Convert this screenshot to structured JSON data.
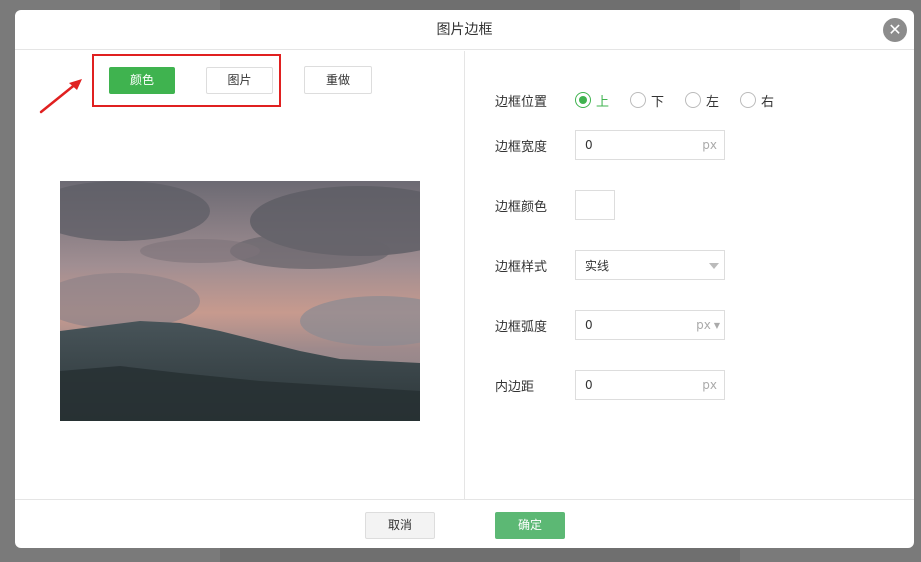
{
  "dialog": {
    "title": "图片边框",
    "close_glyph": "✕"
  },
  "tabs": {
    "color": "颜色",
    "image": "图片",
    "redo": "重做"
  },
  "settings": {
    "position": {
      "label": "边框位置",
      "options": [
        "上",
        "下",
        "左",
        "右"
      ],
      "selected": "上"
    },
    "width": {
      "label": "边框宽度",
      "value": "0",
      "unit": "px"
    },
    "color": {
      "label": "边框颜色",
      "value": "#ffffff"
    },
    "style": {
      "label": "边框样式",
      "value": "实线"
    },
    "radius": {
      "label": "边框弧度",
      "value": "0",
      "unit": "px"
    },
    "padding": {
      "label": "内边距",
      "value": "0",
      "unit": "px"
    }
  },
  "footer": {
    "cancel": "取消",
    "ok": "确定"
  },
  "colors": {
    "accent": "#3fb34f",
    "ok_button": "#5cb874",
    "annotation": "#e02020"
  }
}
